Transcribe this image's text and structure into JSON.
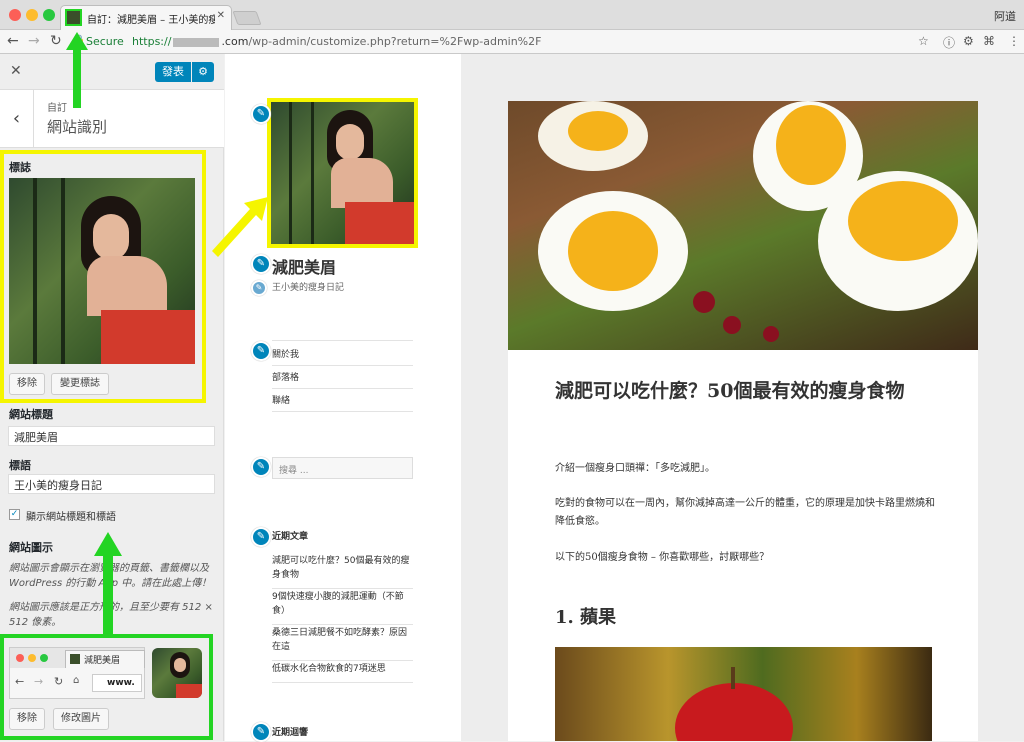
{
  "browser": {
    "tab_title": "自訂：減肥美眉 – 王小美的瘦身",
    "user": "阿道",
    "secure_label": "Secure",
    "url_prefix": "https://",
    "url_domain": ".com",
    "url_path": "/wp-admin/customize.php?return=%2Fwp-admin%2F"
  },
  "customizer": {
    "publish_label": "發表",
    "breadcrumb": "自訂",
    "section_title": "網站識別",
    "logo_label": "標誌",
    "remove_label": "移除",
    "change_logo_label": "變更標誌",
    "site_title_label": "網站標題",
    "site_title_value": "減肥美眉",
    "tagline_label": "標語",
    "tagline_value": "王小美的瘦身日記",
    "display_checkbox_label": "顯示網站標題和標語",
    "site_icon_label": "網站圖示",
    "site_icon_help1": "網站圖示會顯示在瀏覽器的頁籤、書籤欄以及 WordPress 的行動 App 中。請在此處上傳！",
    "site_icon_help2": "網站圖示應該是正方形的，且至少要有 512 × 512 像素。",
    "icon_preview_tab": "減肥美眉",
    "icon_preview_url": "www.",
    "icon_remove_label": "移除",
    "icon_change_label": "修改圖片"
  },
  "preview": {
    "site_title": "減肥美眉",
    "tagline": "王小美的瘦身日記",
    "menu": [
      "關於我",
      "部落格",
      "聯絡"
    ],
    "search_placeholder": "搜尋 ...",
    "recent_posts_title": "近期文章",
    "recent_posts": [
      "減肥可以吃什麼？50個最有效的瘦身食物",
      "9個快速瘦小腹的減肥運動（不節食）",
      "桑德三日減肥餐不如吃酵素？原因在這",
      "低碳水化合物飲食的7項迷思"
    ],
    "recent_comments_title": "近期迴響",
    "post_title": "減肥可以吃什麼？50個最有效的瘦身食物",
    "post_p1": "介紹一個瘦身口頭禪：「多吃減肥」。",
    "post_p2": "吃對的食物可以在一周內，幫你減掉高達一公斤的體重，它的原理是加快卡路里燃燒和降低食慾。",
    "post_p3": "以下的50個瘦身食物 – 你喜歡哪些，討厭哪些？",
    "post_h2": "1. 蘋果"
  },
  "colors": {
    "accent": "#0085ba",
    "highlight_yellow": "#f5f500",
    "highlight_green": "#23d423"
  }
}
